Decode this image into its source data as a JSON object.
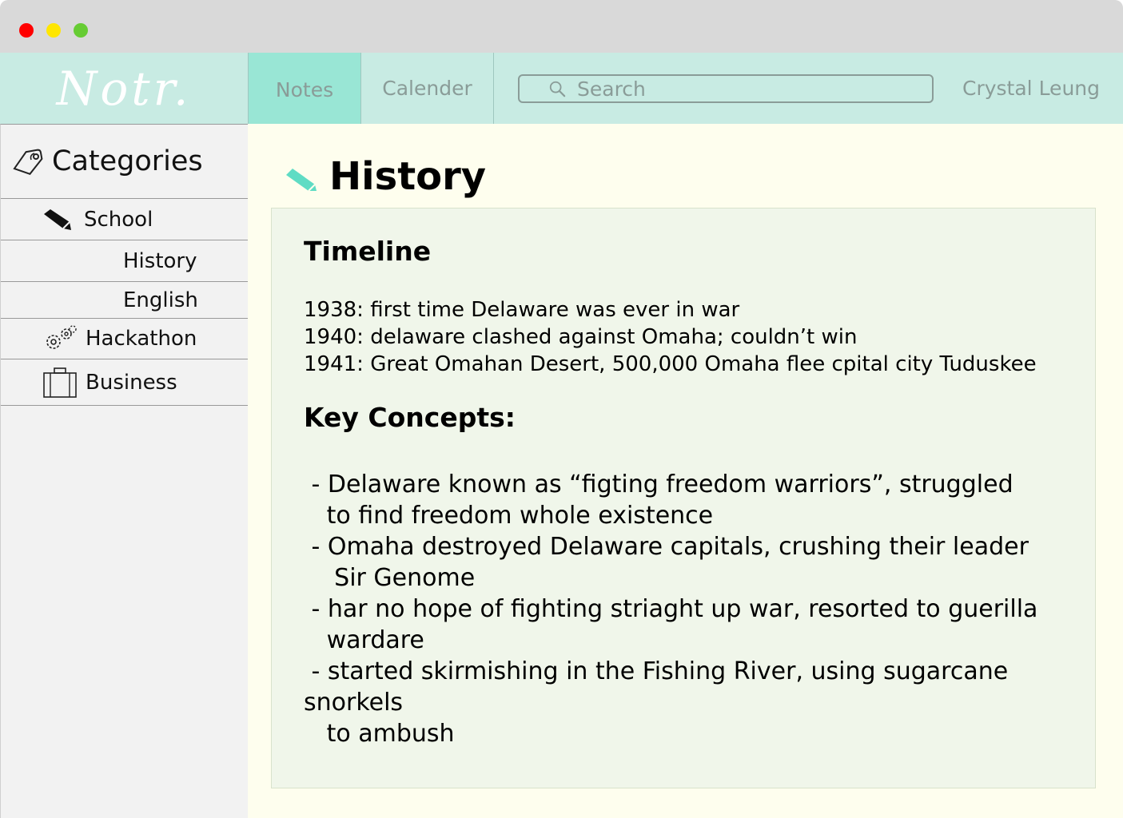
{
  "app": {
    "logo": "Notr."
  },
  "nav": {
    "tabs": [
      {
        "label": "Notes",
        "active": true
      },
      {
        "label": "Calender",
        "active": false
      }
    ],
    "search_placeholder": "Search",
    "user_name": "Crystal Leung"
  },
  "sidebar": {
    "heading": "Categories",
    "items": [
      {
        "label": "School",
        "icon": "pencil-icon"
      },
      {
        "label": "History"
      },
      {
        "label": "English"
      },
      {
        "label": "Hackathon",
        "icon": "gears-icon"
      },
      {
        "label": "Business",
        "icon": "briefcase-icon"
      }
    ]
  },
  "note": {
    "title": "History",
    "section1_heading": "Timeline",
    "timeline_text": "1938: first time Delaware was ever in war\n1940: delaware clashed against Omaha; couldn’t win\n1941: Great Omahan Desert, 500,000 Omaha flee cpital city Tuduskee",
    "section2_heading": "Key Concepts:",
    "concepts_text": " - Delaware known as “figting freedom warriors”, struggled\n   to find freedom whole existence\n - Omaha destroyed Delaware capitals, crushing their leader\n    Sir Genome\n - har no hope of fighting striaght up war, resorted to guerilla\n   wardare\n - started skirmishing in the Fishing River, using sugarcane\nsnorkels\n   to ambush"
  },
  "colors": {
    "accent": "#99e6d5",
    "topbar": "#c8ebe3",
    "content_bg": "#fefeee",
    "card_bg": "#f0f6ea",
    "pencil": "#5fdcc4"
  }
}
